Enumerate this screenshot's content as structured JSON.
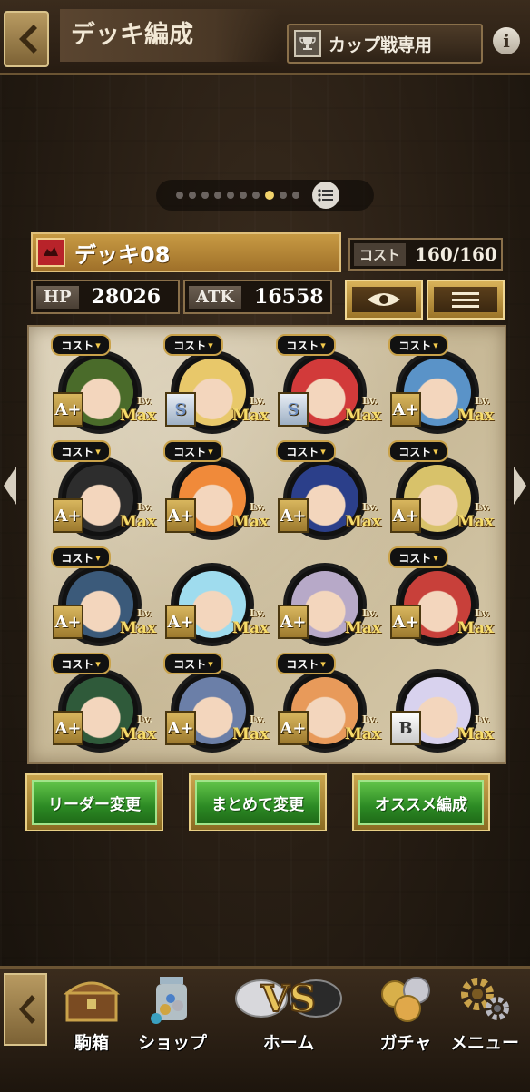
{
  "header": {
    "title": "デッキ編成",
    "cup_button_label": "カップ戦専用",
    "info_label": "i"
  },
  "pager": {
    "total": 10,
    "active_index": 7
  },
  "deck": {
    "name": "デッキ08",
    "cost_tag": "コスト",
    "cost_value": "160/160",
    "hp_tag": "HP",
    "hp_value": "28026",
    "atk_tag": "ATK",
    "atk_value": "16558"
  },
  "units": [
    {
      "cost": "コスト",
      "rank": "A+",
      "rank_style": "gold",
      "lv": "Lv.",
      "max": "Max",
      "accent": "#4a6b2a"
    },
    {
      "cost": "コスト",
      "rank": "S",
      "rank_style": "silver",
      "lv": "Lv.",
      "max": "Max",
      "accent": "#e8c86a"
    },
    {
      "cost": "コスト",
      "rank": "S",
      "rank_style": "silver",
      "lv": "Lv.",
      "max": "Max",
      "accent": "#d23a3a"
    },
    {
      "cost": "コスト",
      "rank": "A+",
      "rank_style": "gold",
      "lv": "Lv.",
      "max": "Max",
      "accent": "#5a93c8"
    },
    {
      "cost": "コスト",
      "rank": "A+",
      "rank_style": "gold",
      "lv": "Lv.",
      "max": "Max",
      "accent": "#2d2d2d"
    },
    {
      "cost": "コスト",
      "rank": "A+",
      "rank_style": "gold",
      "lv": "Lv.",
      "max": "Max",
      "accent": "#f08a3a"
    },
    {
      "cost": "コスト",
      "rank": "A+",
      "rank_style": "gold",
      "lv": "Lv.",
      "max": "Max",
      "accent": "#2b3f8a"
    },
    {
      "cost": "コスト",
      "rank": "A+",
      "rank_style": "gold",
      "lv": "Lv.",
      "max": "Max",
      "accent": "#d8c26a"
    },
    {
      "cost": "コスト",
      "rank": "A+",
      "rank_style": "gold",
      "lv": "Lv.",
      "max": "Max",
      "accent": "#3b5a7a"
    },
    {
      "cost": "",
      "rank": "A+",
      "rank_style": "gold",
      "lv": "Lv.",
      "max": "Max",
      "accent": "#9fdcee"
    },
    {
      "cost": "",
      "rank": "A+",
      "rank_style": "gold",
      "lv": "Lv.",
      "max": "Max",
      "accent": "#b7a9c8"
    },
    {
      "cost": "コスト",
      "rank": "A+",
      "rank_style": "gold",
      "lv": "Lv.",
      "max": "Max",
      "accent": "#c8403a"
    },
    {
      "cost": "コスト",
      "rank": "A+",
      "rank_style": "gold",
      "lv": "Lv.",
      "max": "Max",
      "accent": "#2f5a3a"
    },
    {
      "cost": "コスト",
      "rank": "A+",
      "rank_style": "gold",
      "lv": "Lv.",
      "max": "Max",
      "accent": "#6b7fa8"
    },
    {
      "cost": "コスト",
      "rank": "A+",
      "rank_style": "gold",
      "lv": "Lv.",
      "max": "Max",
      "accent": "#e89a5a"
    },
    {
      "cost": "",
      "rank": "B",
      "rank_style": "white",
      "lv": "Lv.",
      "max": "Max",
      "accent": "#d8d2ee"
    }
  ],
  "actions": {
    "leader_change": "リーダー変更",
    "bulk_change": "まとめて変更",
    "recommend": "オススメ編成"
  },
  "nav": {
    "box": "駒箱",
    "shop": "ショップ",
    "home": "ホーム",
    "gacha": "ガチャ",
    "menu": "メニュー"
  },
  "colors": {
    "gold": "#c79a43",
    "green": "#2c8a24",
    "bg": "#241b12"
  }
}
